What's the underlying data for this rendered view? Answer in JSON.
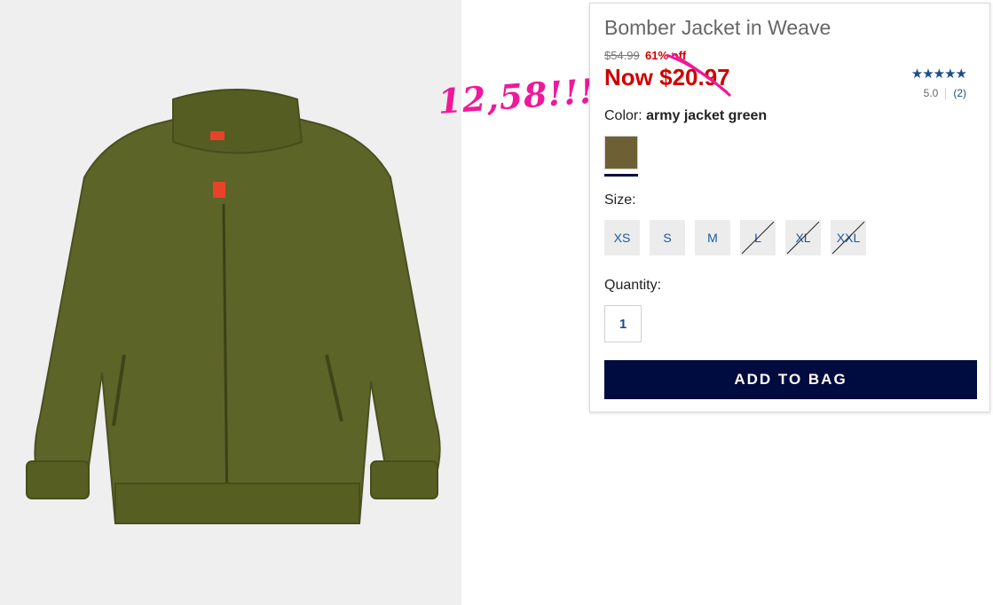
{
  "product": {
    "title": "Bomber Jacket in Weave",
    "original_price": "$54.99",
    "percent_off": "61% off",
    "now_price": "Now $20.97"
  },
  "annotation": {
    "text": "12,58!!!",
    "color": "#f0189a"
  },
  "rating": {
    "stars": "★★★★★",
    "score": "5.0",
    "count": "(2)"
  },
  "color": {
    "label": "Color: ",
    "value": "army jacket green",
    "swatch_hex": "#6e6035"
  },
  "size": {
    "label": "Size:",
    "options": [
      {
        "label": "XS",
        "available": true
      },
      {
        "label": "S",
        "available": true
      },
      {
        "label": "M",
        "available": true
      },
      {
        "label": "L",
        "available": false
      },
      {
        "label": "XL",
        "available": false
      },
      {
        "label": "XXL",
        "available": false
      }
    ]
  },
  "quantity": {
    "label": "Quantity:",
    "value": "1"
  },
  "cta": {
    "add_to_bag": "ADD TO BAG",
    "color": "#000b3f"
  }
}
